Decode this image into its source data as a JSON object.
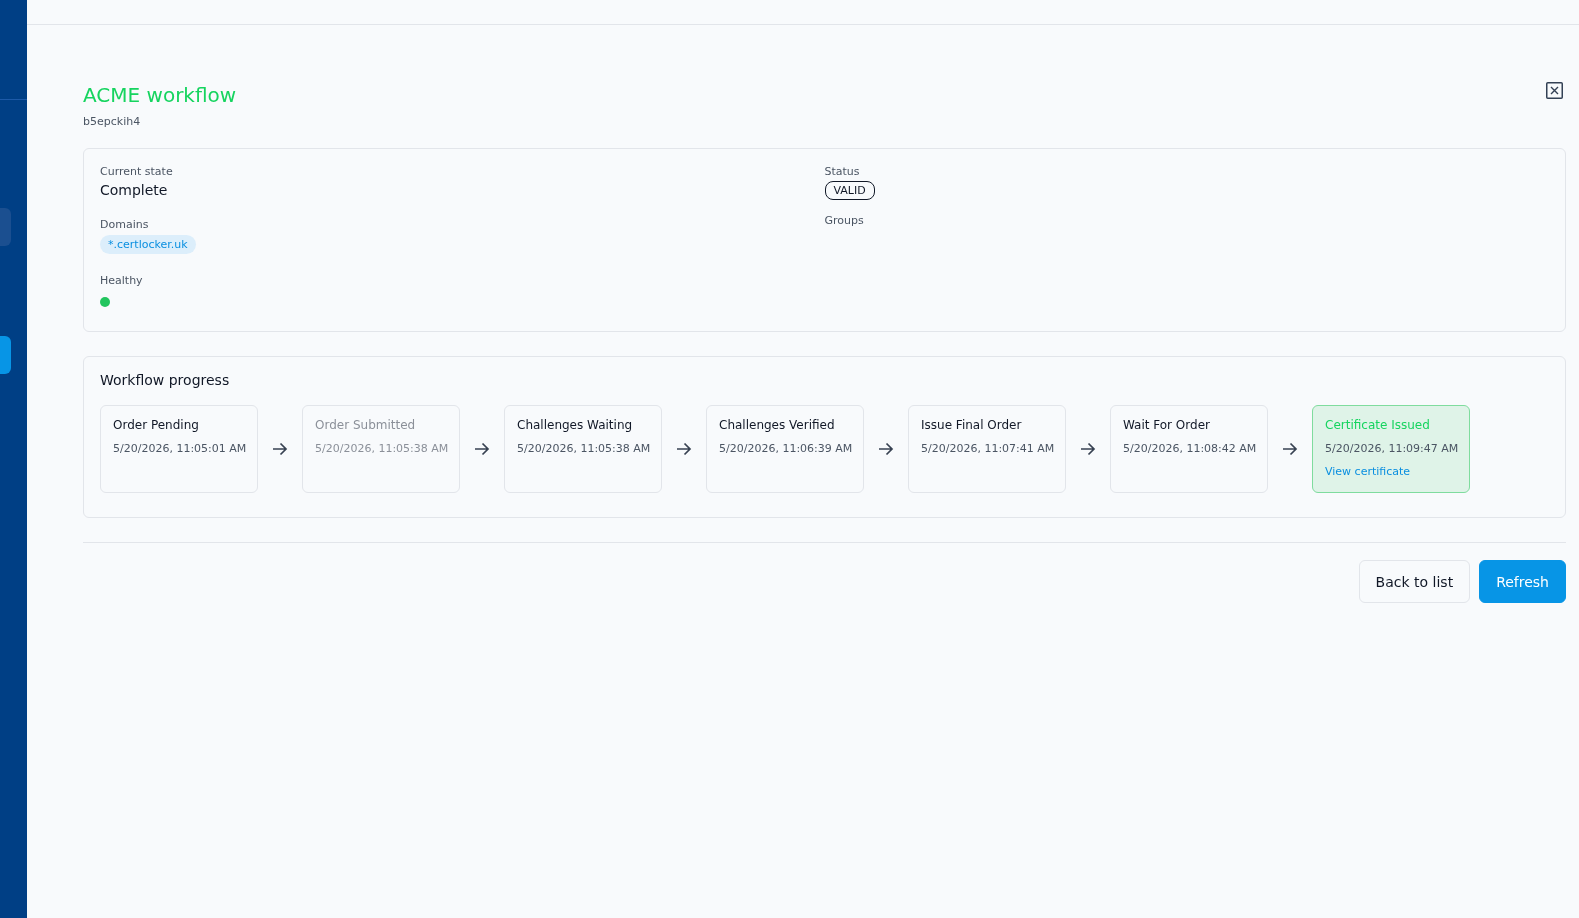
{
  "sidebar": {
    "items": [
      {
        "selected": false
      },
      {
        "selected": true
      }
    ]
  },
  "title": "ACME workflow",
  "subtitle": "b5epckih4",
  "details": {
    "current_state_label": "Current state",
    "current_state": "Complete",
    "status_label": "Status",
    "status": "VALID",
    "domains_label": "Domains",
    "domains": [
      "*.certlocker.uk"
    ],
    "groups_label": "Groups",
    "healthy_label": "Healthy",
    "healthy": true
  },
  "workflow": {
    "title": "Workflow progress",
    "steps": [
      {
        "name": "Order Pending",
        "time": "5/20/2026, 11:05:01 AM",
        "kind": "done"
      },
      {
        "name": "Order Submitted",
        "time": "5/20/2026, 11:05:38 AM",
        "kind": "muted"
      },
      {
        "name": "Challenges Waiting",
        "time": "5/20/2026, 11:05:38 AM",
        "kind": "done"
      },
      {
        "name": "Challenges Verified",
        "time": "5/20/2026, 11:06:39 AM",
        "kind": "done"
      },
      {
        "name": "Issue Final Order",
        "time": "5/20/2026, 11:07:41 AM",
        "kind": "done"
      },
      {
        "name": "Wait For Order",
        "time": "5/20/2026, 11:08:42 AM",
        "kind": "done"
      },
      {
        "name": "Certificate Issued",
        "time": "5/20/2026, 11:09:47 AM",
        "kind": "final",
        "link": "View certificate"
      }
    ]
  },
  "buttons": [
    {
      "label": "Back to list",
      "kind": "secondary"
    },
    {
      "label": "Refresh",
      "kind": "primary"
    }
  ]
}
